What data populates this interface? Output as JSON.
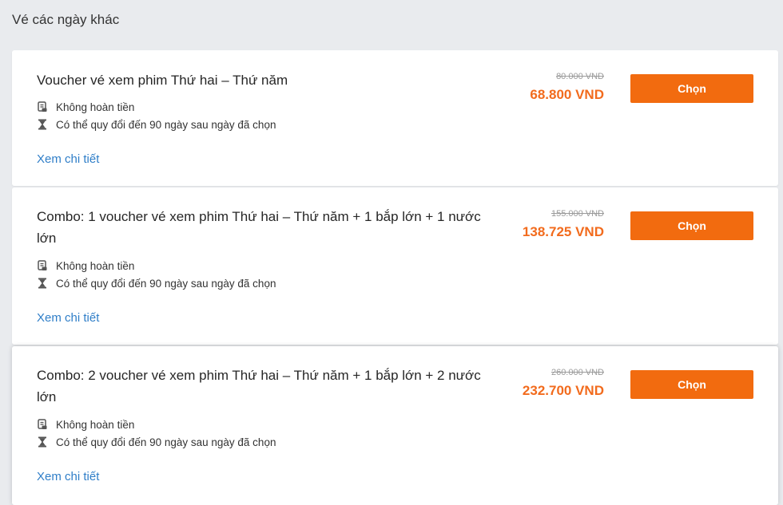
{
  "section": {
    "title": "Vé các ngày khác"
  },
  "cards": [
    {
      "title": "Voucher vé xem phim Thứ hai – Thứ năm",
      "features": [
        {
          "icon": "document-icon",
          "text": "Không hoàn tiền"
        },
        {
          "icon": "hourglass-icon",
          "text": "Có thể quy đổi đến 90 ngày sau ngày đã chọn"
        }
      ],
      "details_label": "Xem chi tiết",
      "old_price": "80.000 VND",
      "new_price": "68.800 VND",
      "button_label": "Chọn"
    },
    {
      "title": "Combo: 1 voucher vé xem phim Thứ hai – Thứ năm + 1 bắp lớn + 1 nước lớn",
      "features": [
        {
          "icon": "document-icon",
          "text": "Không hoàn tiền"
        },
        {
          "icon": "hourglass-icon",
          "text": "Có thể quy đổi đến 90 ngày sau ngày đã chọn"
        }
      ],
      "details_label": "Xem chi tiết",
      "old_price": "155.000 VND",
      "new_price": "138.725 VND",
      "button_label": "Chọn"
    },
    {
      "title": "Combo: 2 voucher vé xem phim Thứ hai – Thứ năm + 1 bắp lớn + 2 nước lớn",
      "features": [
        {
          "icon": "document-icon",
          "text": "Không hoàn tiền"
        },
        {
          "icon": "hourglass-icon",
          "text": "Có thể quy đổi đến 90 ngày sau ngày đã chọn"
        }
      ],
      "details_label": "Xem chi tiết",
      "old_price": "260.000 VND",
      "new_price": "232.700 VND",
      "button_label": "Chọn"
    }
  ],
  "colors": {
    "accent": "#f26b0f",
    "price": "#f26b1d",
    "link": "#2f7ec8",
    "background": "#e9ebee"
  }
}
